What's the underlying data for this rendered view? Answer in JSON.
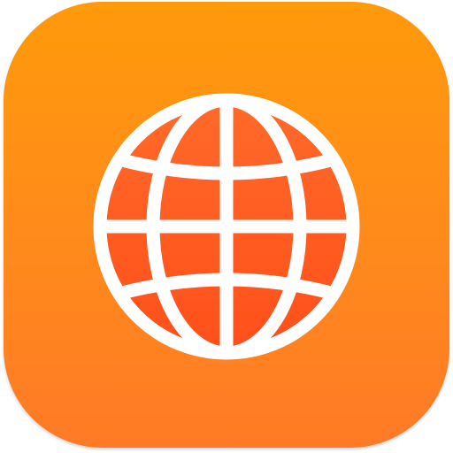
{
  "app_icon": {
    "name": "globe-app-icon",
    "icon": "globe-icon"
  },
  "colors": {
    "background_top": "#ff9a0a",
    "background_bottom": "#ff7a26",
    "globe_fill_top": "#ff6a2a",
    "globe_fill_bottom": "#ff4f1a",
    "globe_lines": "#ffffff"
  }
}
